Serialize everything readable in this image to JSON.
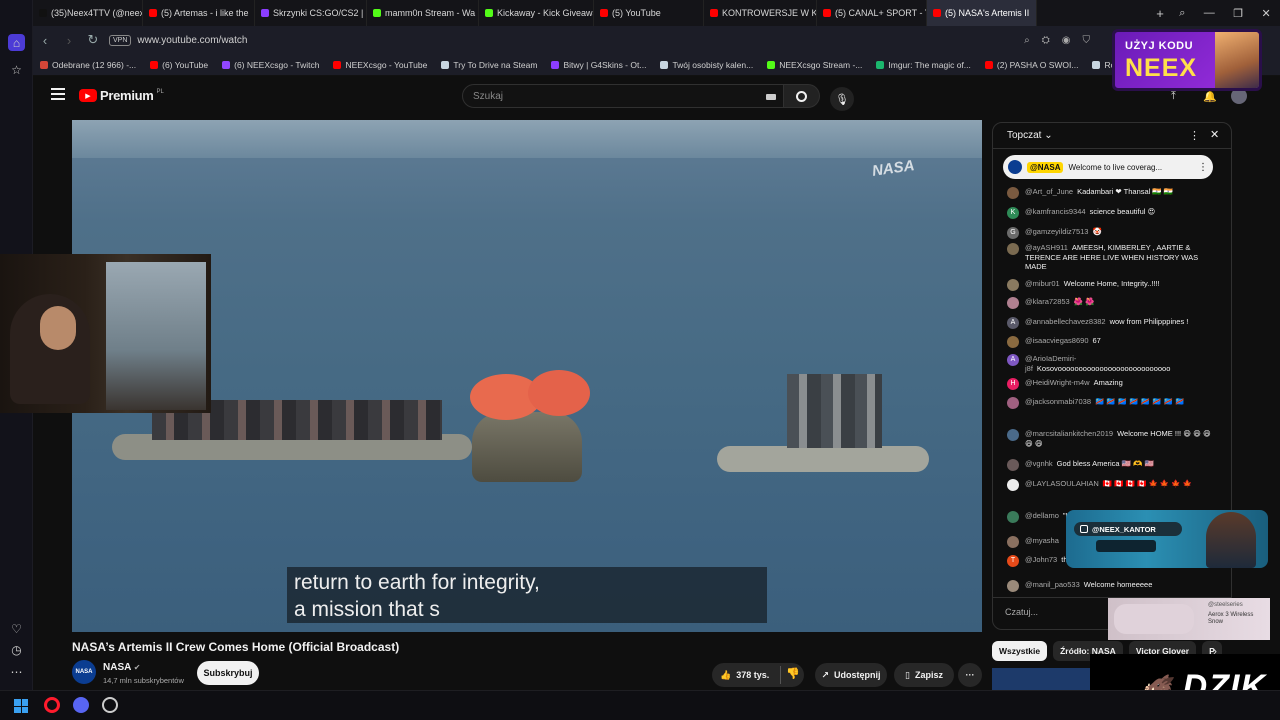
{
  "browser": {
    "tabs": [
      {
        "label": "(35)Neex4TTV (@neex4tt",
        "color": "#111111"
      },
      {
        "label": "(5) Artemas - i like the",
        "color": "#ff0000"
      },
      {
        "label": "Skrzynki CS:GO/CS2 | G4S",
        "color": "#8b3dff"
      },
      {
        "label": "mamm0n Stream - Wa",
        "color": "#53fc18"
      },
      {
        "label": "Kickaway - Kick Giveaway",
        "color": "#53fc18"
      },
      {
        "label": "(5) YouTube",
        "color": "#ff0000"
      },
      {
        "label": "KONTROWERSJE W KOŃC",
        "color": "#ff0000"
      },
      {
        "label": "(5) CANAL+ SPORT - YouT",
        "color": "#ff0000"
      },
      {
        "label": "(5) NASA's Artemis II",
        "color": "#ff0000"
      }
    ],
    "new_tab": "+",
    "vpn_label": "VPN",
    "url": "www.youtube.com/watch",
    "bookmarks": [
      {
        "label": "Odebrane (12 966) -...",
        "color": "#d44638"
      },
      {
        "label": "(6) YouTube",
        "color": "#ff0000"
      },
      {
        "label": "(6) NEEXcsgo - Twitch",
        "color": "#9146ff"
      },
      {
        "label": "NEEXcsgo - YouTube",
        "color": "#ff0000"
      },
      {
        "label": "Try To Drive na Steam",
        "color": "#c7d5e0"
      },
      {
        "label": "Bitwy | G4Skins - Ot...",
        "color": "#8b3dff"
      },
      {
        "label": "Twój osobisty kalen...",
        "color": "#c7d5e0"
      },
      {
        "label": "NEEXcsgo Stream -...",
        "color": "#53fc18"
      },
      {
        "label": "Imgur: The magic of...",
        "color": "#1bb76e"
      },
      {
        "label": "(2) PASHA O SWOI...",
        "color": "#ff0000"
      },
      {
        "label": "Rosalie na Steam",
        "color": "#c7d5e0"
      }
    ]
  },
  "youtube": {
    "logo_text": "Premium",
    "logo_region": "PL",
    "search_placeholder": "Szukaj",
    "caption_line1": "return to earth for integrity,",
    "caption_line2": "a mission that s",
    "video_watermark": "NASA",
    "video_title": "NASA’s Artemis II Crew Comes Home (Official Broadcast)",
    "channel_name": "NASA",
    "channel_logo": "NASA",
    "subscribers": "14,7 mln subskrybentów",
    "subscribe_label": "Subskrybuj",
    "likes": "378 tys.",
    "share_label": "Udostępnij",
    "save_label": "Zapisz",
    "more_label": "···"
  },
  "chat": {
    "header_label": "Topczat",
    "pinned_author": "@NASA",
    "pinned_text": "Welcome to live coverag...",
    "input_placeholder": "Czatuj...",
    "messages": [
      {
        "author": "@Art_of_June",
        "text": "Kadambari ❤ Thansal 🇮🇳 🇮🇳",
        "avatar": "",
        "avatar_color": "#7a5a40"
      },
      {
        "author": "@kamfrancis9344",
        "text": "science beautiful 😍",
        "avatar": "K",
        "avatar_color": "#2e8b57"
      },
      {
        "author": "@gamzeyildiz7513",
        "text": "🤡",
        "avatar": "G",
        "avatar_color": "#6b6b6b"
      },
      {
        "author": "@ayASH911",
        "text": "AMEESH, KIMBERLEY , AARTIE & TERENCE ARE HERE LIVE WHEN HISTORY WAS MADE",
        "avatar": "",
        "avatar_color": "#7a6a50"
      },
      {
        "author": "@mibur01",
        "text": "Welcome Home, Integrity..!!!!",
        "avatar": "",
        "avatar_color": "#8a7a60"
      },
      {
        "author": "@klara72853",
        "text": "🌺 🌺",
        "avatar": "",
        "avatar_color": "#b08090"
      },
      {
        "author": "@annabellechavez8382",
        "text": "wow from Philipppines !",
        "avatar": "A",
        "avatar_color": "#5a5a6a"
      },
      {
        "author": "@isaacviegas8690",
        "text": "67",
        "avatar": "",
        "avatar_color": "#8a6a40"
      },
      {
        "author": "@ArioIaDemiri-j8f",
        "text": "Kosovooooooooooooooooooooooooooo",
        "avatar": "A",
        "avatar_color": "#7e57c2"
      },
      {
        "author": "@HeidiWright-m4w",
        "text": "Amazing",
        "avatar": "H",
        "avatar_color": "#e91e63"
      },
      {
        "author": "@jacksonmabi7038",
        "text": "🇨🇩 🇨🇩 🇨🇩 🇨🇩 🇨🇩 🇨🇩 🇨🇩 🇨🇩",
        "avatar": "",
        "avatar_color": "#a06080"
      },
      {
        "author": "@marcsitaliankitchen2019",
        "text": "Welcome HOME !!! 😄 😄 😄 😄 😄",
        "avatar": "",
        "avatar_color": "#4a6a8a"
      },
      {
        "author": "@vgnhk",
        "text": "God bless America 🇺🇸 🫶 🇺🇸",
        "avatar": "",
        "avatar_color": "#6a5a5a"
      },
      {
        "author": "@LAYLASOULAHIAN",
        "text": "🇨🇦 🇨🇦 🇨🇦 🇨🇦 🍁 🍁 🍁 🍁",
        "avatar": "",
        "avatar_color": "#eeeeee"
      },
      {
        "author": "@dellamo",
        "text": "\"Integrity\"",
        "avatar": "",
        "avatar_color": "#3a7a5a"
      },
      {
        "author": "@myasha",
        "text": "",
        "avatar": "",
        "avatar_color": "#8a7060"
      },
      {
        "author": "@John73",
        "text": "the boat to start a video.",
        "avatar": "T",
        "avatar_color": "#e64a19"
      },
      {
        "author": "@manil_pao533",
        "text": "Welcome homeeeee",
        "avatar": "",
        "avatar_color": "#9a8a7a"
      }
    ]
  },
  "chips": [
    "Wszystkie",
    "Źródło: NASA",
    "Victor Glover",
    "P"
  ],
  "overlays": {
    "promo_line1": "UŻYJ KODU",
    "promo_line2": "NEEX",
    "insta_handle": "@NEEX_KANTOR",
    "steel_text": "Aerox 3 Wireless Snow",
    "steel_brand": "@steelseries",
    "dzik_logo": "DZIK"
  }
}
